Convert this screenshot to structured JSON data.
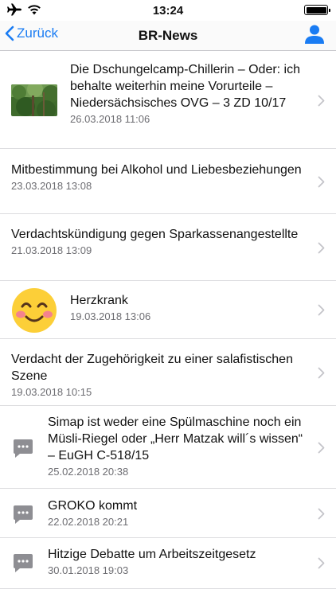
{
  "status_bar": {
    "time": "13:24"
  },
  "nav": {
    "back_label": "Zurück",
    "title": "BR-News"
  },
  "colors": {
    "accent": "#1a7cf3",
    "separator": "#dcdcdf",
    "date_text": "#6d6d72"
  },
  "news": [
    {
      "title": "Die Dschungelcamp-Chillerin – Oder: ich behalte weiterhin meine Vorurteile – Niedersächsisches OVG – 3 ZD 10/17",
      "date": "26.03.2018 11:06",
      "thumbnail": "jungle-photo"
    },
    {
      "title": "Mitbestimmung bei Alkohol und Liebesbeziehungen",
      "date": "23.03.2018 13:08",
      "thumbnail": "none"
    },
    {
      "title": "Verdachtskündigung gegen Sparkassenangestellte",
      "date": "21.03.2018 13:09",
      "thumbnail": "none"
    },
    {
      "title": "Herzkrank",
      "date": "19.03.2018 13:06",
      "thumbnail": "smiley-emoji"
    },
    {
      "title": "Verdacht der Zugehörigkeit zu einer salafistischen Szene",
      "date": "19.03.2018 10:15",
      "thumbnail": "none"
    },
    {
      "title": "Simap ist weder eine Spülmaschine noch ein Müsli-Riegel oder „Herr Matzak will´s wissen“ – EuGH C-518/15",
      "date": "25.02.2018 20:38",
      "thumbnail": "chat-icon"
    },
    {
      "title": "GROKO kommt",
      "date": "22.02.2018 20:21",
      "thumbnail": "chat-icon"
    },
    {
      "title": "Hitzige Debatte um Arbeitszeitgesetz",
      "date": "30.01.2018 19:03",
      "thumbnail": "chat-icon"
    }
  ]
}
